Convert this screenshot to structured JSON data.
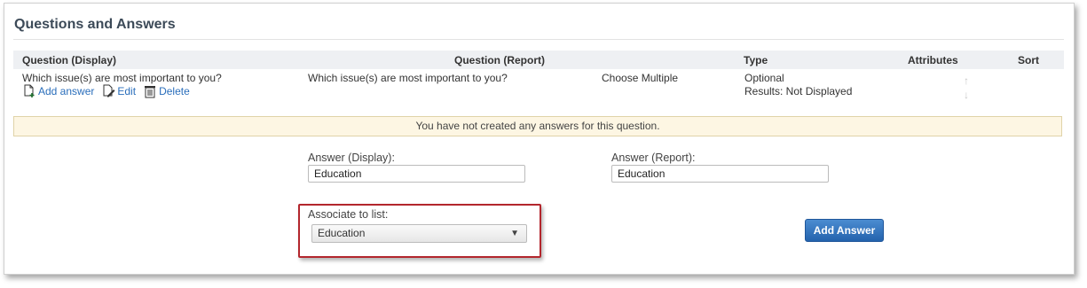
{
  "panel": {
    "title": "Questions and Answers"
  },
  "table": {
    "headers": [
      "Question (Display)",
      "Question (Report)",
      "Type",
      "Attributes",
      "Sort"
    ],
    "row": {
      "question_display": "Which issue(s) are most important to you?",
      "question_report": "Which issue(s) are most important to you?",
      "question_type": "Choose Multiple",
      "attribute_optional": "Optional",
      "attribute_results": "Results: Not Displayed"
    },
    "actions": {
      "add_answer": "Add answer",
      "edit": "Edit",
      "delete": "Delete"
    }
  },
  "notice": "You have not created any answers for this question.",
  "form": {
    "answer_display_label": "Answer (Display):",
    "answer_display_value": "Education",
    "answer_report_label": "Answer (Report):",
    "answer_report_value": "Education",
    "associate_label": "Associate to list:",
    "associate_selected": "Education",
    "add_button": "Add Answer"
  },
  "icons": {
    "add": "add-document-icon",
    "edit": "edit-document-icon",
    "delete": "trash-icon",
    "sort_up": "arrow-up-icon",
    "sort_down": "arrow-down-icon",
    "select_caret": "caret-down-icon"
  },
  "colors": {
    "title": "#3c4a58",
    "link": "#2a6ebb",
    "notice_bg": "#fdf6e3",
    "highlight_border": "#b3262d",
    "button_blue": "#2463ad"
  }
}
